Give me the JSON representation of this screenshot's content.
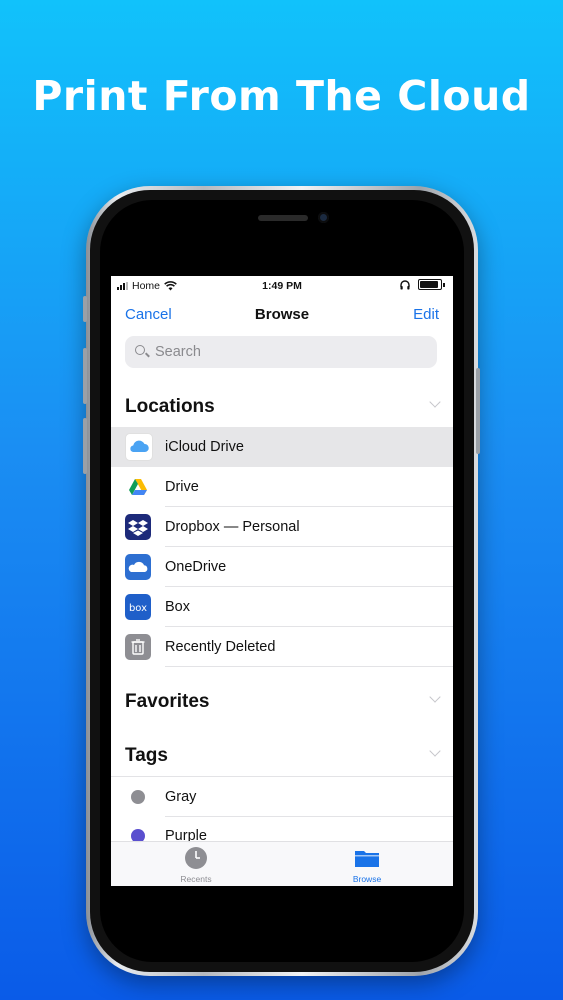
{
  "headline": "Print From The Cloud",
  "status_bar": {
    "carrier": "Home",
    "time": "1:49 PM"
  },
  "nav": {
    "cancel": "Cancel",
    "title": "Browse",
    "edit": "Edit"
  },
  "search": {
    "placeholder": "Search"
  },
  "sections": {
    "locations": "Locations",
    "favorites": "Favorites",
    "tags": "Tags"
  },
  "locations": [
    {
      "label": "iCloud Drive",
      "icon": "icloud-drive-icon",
      "selected": true
    },
    {
      "label": "Drive",
      "icon": "google-drive-icon"
    },
    {
      "label": "Dropbox — Personal",
      "icon": "dropbox-icon"
    },
    {
      "label": "OneDrive",
      "icon": "onedrive-icon"
    },
    {
      "label": "Box",
      "icon": "box-icon"
    },
    {
      "label": "Recently Deleted",
      "icon": "trash-icon"
    }
  ],
  "tags": [
    {
      "label": "Gray",
      "color": "#8e8e93"
    },
    {
      "label": "Purple",
      "color": "#5a4fcf"
    }
  ],
  "tabbar": {
    "recents": "Recents",
    "browse": "Browse"
  },
  "colors": {
    "accent": "#1a73e8",
    "background_top": "#11c2fb",
    "background_bottom": "#0a5be8"
  }
}
